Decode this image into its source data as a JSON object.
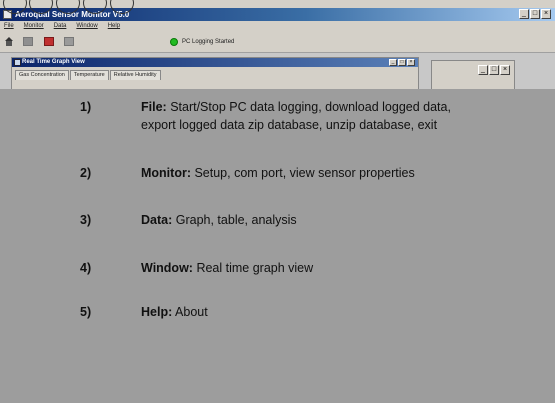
{
  "window": {
    "title": "Aeroqual Sensor Monitor V5.0"
  },
  "menubar": [
    "File",
    "Monitor",
    "Data",
    "Window",
    "Help"
  ],
  "toolbar": {
    "status_text": "PC Logging Started"
  },
  "child_window": {
    "title": "Real Time Graph View",
    "tabs": [
      "Gas Concentration",
      "Temperature",
      "Relative Humidity"
    ]
  },
  "annotations": [
    {
      "num": "1)",
      "key": "File:",
      "text": "Start/Stop PC data logging, download logged data,",
      "text2": "export logged data zip database, unzip database, exit"
    },
    {
      "num": "2)",
      "key": "Monitor:",
      "text": "Setup, com port, view sensor properties"
    },
    {
      "num": "3)",
      "key": "Data:",
      "text": "Graph, table, analysis"
    },
    {
      "num": "4)",
      "key": "Window:",
      "text": "Real time graph view"
    },
    {
      "num": "5)",
      "key": "Help:",
      "text": "About"
    }
  ]
}
